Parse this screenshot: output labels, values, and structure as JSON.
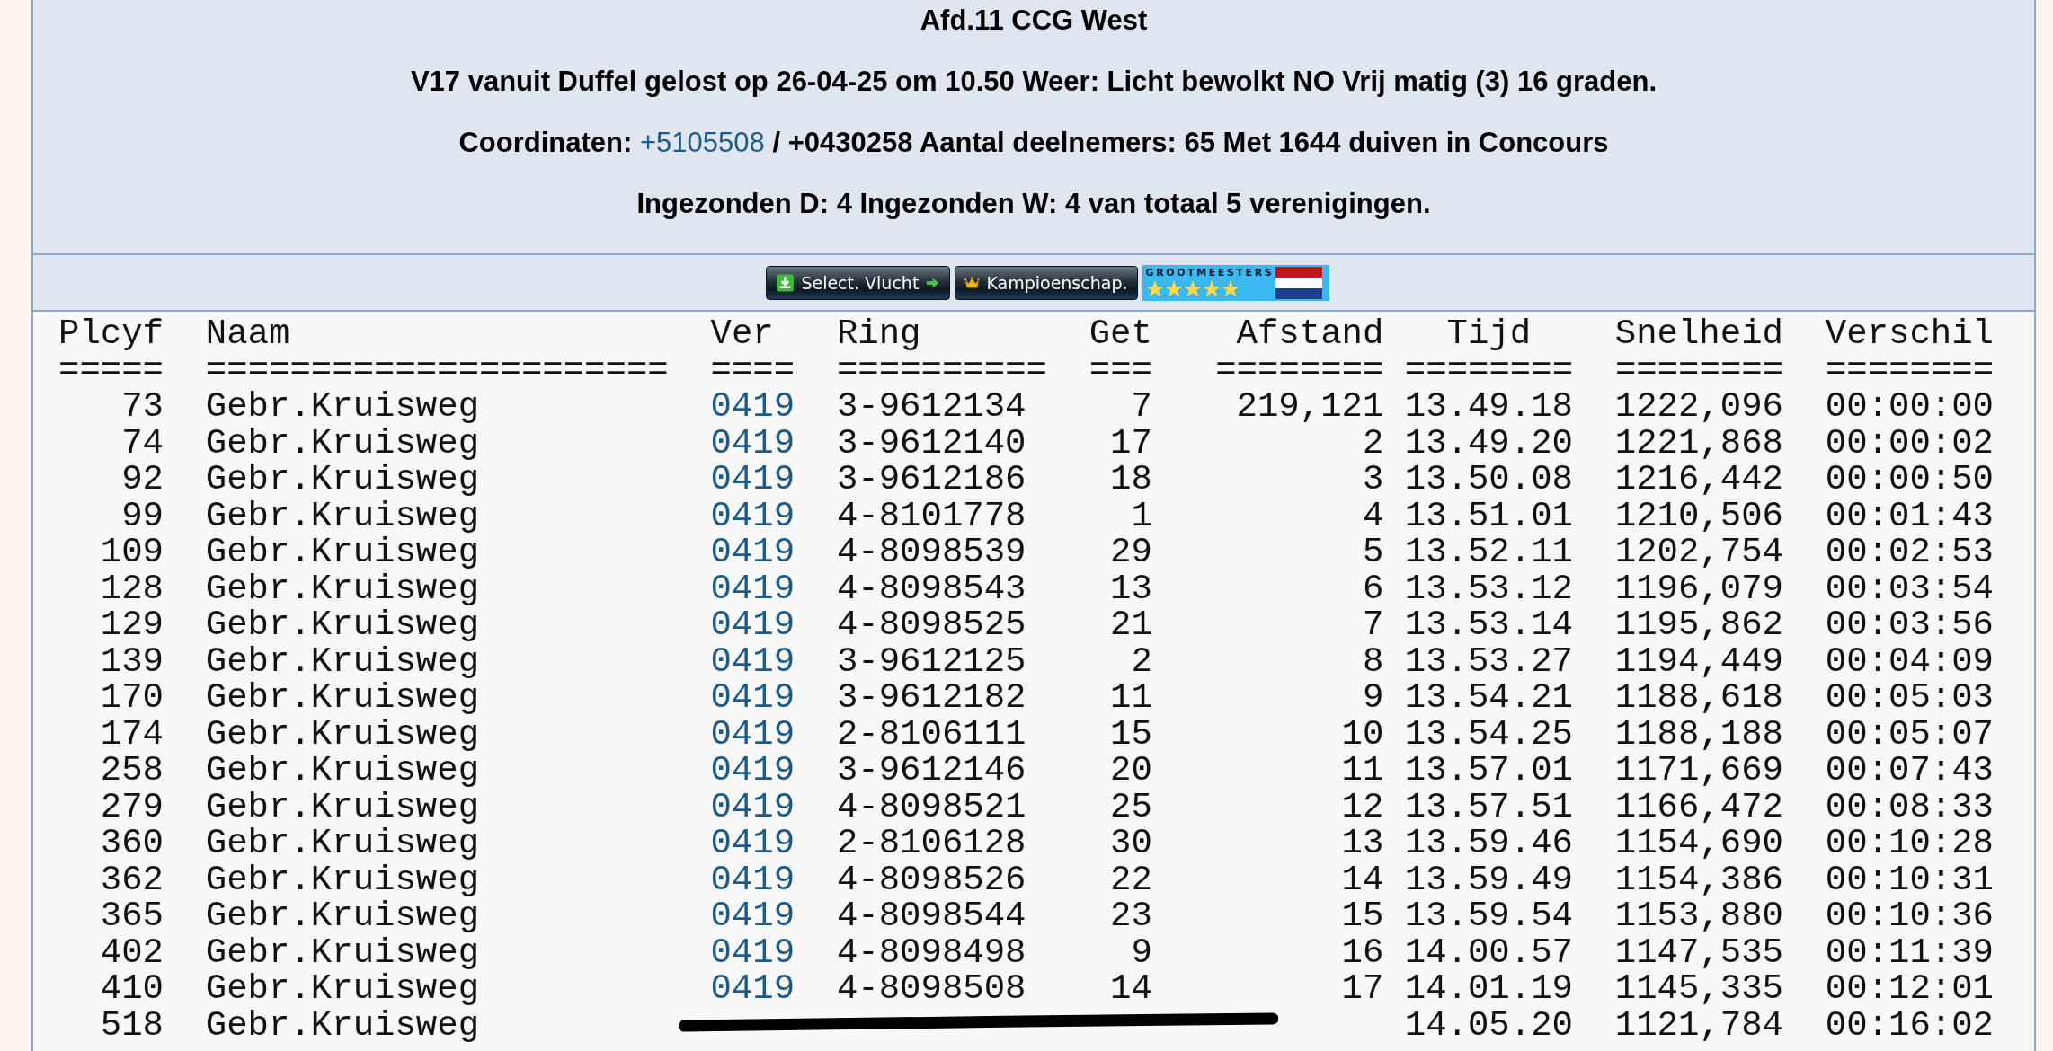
{
  "header": {
    "title": "Afd.11 CCG West",
    "flight_line": "V17 vanuit Duffel gelost op 26-04-25 om 10.50 Weer: Licht bewolkt NO Vrij matig (3) 16 graden.",
    "coordinates": {
      "label": "Coordinaten:",
      "link": "+5105508",
      "rest": "/ +0430258 Aantal deelnemers: 65 Met 1644 duiven in Concours"
    },
    "submitted_line": "Ingezonden D: 4 Ingezonden W: 4 van totaal 5 verenigingen."
  },
  "buttons": [
    {
      "kind": "select",
      "label": "Select. Vlucht"
    },
    {
      "kind": "championship",
      "label": "Kampioenschap."
    },
    {
      "kind": "badge",
      "label": "GROOTMEESTERS",
      "stars": 5
    }
  ],
  "table": {
    "columns": [
      "Plcyf",
      "Naam",
      "Ver",
      "Ring",
      "Get",
      "Afstand",
      "Tijd",
      "Snelheid",
      "Verschil"
    ],
    "rule_line": "=====  ======================  ====  ==========  ===   ======== ========  ========  ========",
    "rows": [
      {
        "plcyf": "73",
        "naam": "Gebr.Kruisweg",
        "ver": "0419",
        "ring": "3-9612134",
        "get": "7",
        "afstand": "219,121",
        "tijd": "13.49.18",
        "snelheid": "1222,096",
        "verschil": "00:00:00",
        "obscured": false
      },
      {
        "plcyf": "74",
        "naam": "Gebr.Kruisweg",
        "ver": "0419",
        "ring": "3-9612140",
        "get": "17",
        "afstand": "2",
        "tijd": "13.49.20",
        "snelheid": "1221,868",
        "verschil": "00:00:02",
        "obscured": false
      },
      {
        "plcyf": "92",
        "naam": "Gebr.Kruisweg",
        "ver": "0419",
        "ring": "3-9612186",
        "get": "18",
        "afstand": "3",
        "tijd": "13.50.08",
        "snelheid": "1216,442",
        "verschil": "00:00:50",
        "obscured": false
      },
      {
        "plcyf": "99",
        "naam": "Gebr.Kruisweg",
        "ver": "0419",
        "ring": "4-8101778",
        "get": "1",
        "afstand": "4",
        "tijd": "13.51.01",
        "snelheid": "1210,506",
        "verschil": "00:01:43",
        "obscured": false
      },
      {
        "plcyf": "109",
        "naam": "Gebr.Kruisweg",
        "ver": "0419",
        "ring": "4-8098539",
        "get": "29",
        "afstand": "5",
        "tijd": "13.52.11",
        "snelheid": "1202,754",
        "verschil": "00:02:53",
        "obscured": false
      },
      {
        "plcyf": "128",
        "naam": "Gebr.Kruisweg",
        "ver": "0419",
        "ring": "4-8098543",
        "get": "13",
        "afstand": "6",
        "tijd": "13.53.12",
        "snelheid": "1196,079",
        "verschil": "00:03:54",
        "obscured": false
      },
      {
        "plcyf": "129",
        "naam": "Gebr.Kruisweg",
        "ver": "0419",
        "ring": "4-8098525",
        "get": "21",
        "afstand": "7",
        "tijd": "13.53.14",
        "snelheid": "1195,862",
        "verschil": "00:03:56",
        "obscured": false
      },
      {
        "plcyf": "139",
        "naam": "Gebr.Kruisweg",
        "ver": "0419",
        "ring": "3-9612125",
        "get": "2",
        "afstand": "8",
        "tijd": "13.53.27",
        "snelheid": "1194,449",
        "verschil": "00:04:09",
        "obscured": false
      },
      {
        "plcyf": "170",
        "naam": "Gebr.Kruisweg",
        "ver": "0419",
        "ring": "3-9612182",
        "get": "11",
        "afstand": "9",
        "tijd": "13.54.21",
        "snelheid": "1188,618",
        "verschil": "00:05:03",
        "obscured": false
      },
      {
        "plcyf": "174",
        "naam": "Gebr.Kruisweg",
        "ver": "0419",
        "ring": "2-8106111",
        "get": "15",
        "afstand": "10",
        "tijd": "13.54.25",
        "snelheid": "1188,188",
        "verschil": "00:05:07",
        "obscured": false
      },
      {
        "plcyf": "258",
        "naam": "Gebr.Kruisweg",
        "ver": "0419",
        "ring": "3-9612146",
        "get": "20",
        "afstand": "11",
        "tijd": "13.57.01",
        "snelheid": "1171,669",
        "verschil": "00:07:43",
        "obscured": false
      },
      {
        "plcyf": "279",
        "naam": "Gebr.Kruisweg",
        "ver": "0419",
        "ring": "4-8098521",
        "get": "25",
        "afstand": "12",
        "tijd": "13.57.51",
        "snelheid": "1166,472",
        "verschil": "00:08:33",
        "obscured": false
      },
      {
        "plcyf": "360",
        "naam": "Gebr.Kruisweg",
        "ver": "0419",
        "ring": "2-8106128",
        "get": "30",
        "afstand": "13",
        "tijd": "13.59.46",
        "snelheid": "1154,690",
        "verschil": "00:10:28",
        "obscured": false
      },
      {
        "plcyf": "362",
        "naam": "Gebr.Kruisweg",
        "ver": "0419",
        "ring": "4-8098526",
        "get": "22",
        "afstand": "14",
        "tijd": "13.59.49",
        "snelheid": "1154,386",
        "verschil": "00:10:31",
        "obscured": false
      },
      {
        "plcyf": "365",
        "naam": "Gebr.Kruisweg",
        "ver": "0419",
        "ring": "4-8098544",
        "get": "23",
        "afstand": "15",
        "tijd": "13.59.54",
        "snelheid": "1153,880",
        "verschil": "00:10:36",
        "obscured": false
      },
      {
        "plcyf": "402",
        "naam": "Gebr.Kruisweg",
        "ver": "0419",
        "ring": "4-8098498",
        "get": "9",
        "afstand": "16",
        "tijd": "14.00.57",
        "snelheid": "1147,535",
        "verschil": "00:11:39",
        "obscured": false
      },
      {
        "plcyf": "410",
        "naam": "Gebr.Kruisweg",
        "ver": "0419",
        "ring": "4-8098508",
        "get": "14",
        "afstand": "17",
        "tijd": "14.01.19",
        "snelheid": "1145,335",
        "verschil": "00:12:01",
        "obscured": false
      },
      {
        "plcyf": "518",
        "naam": "Gebr.Kruisweg",
        "tijd": "14.05.20",
        "snelheid": "1121,784",
        "verschil": "00:16:02",
        "obscured": true
      }
    ]
  }
}
